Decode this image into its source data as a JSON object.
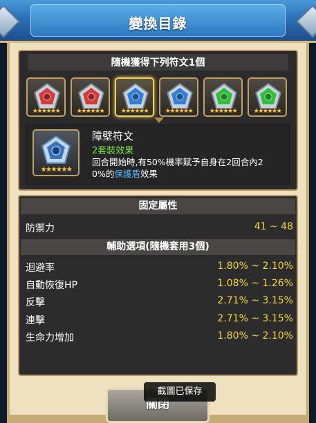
{
  "dialog": {
    "title": "變換目錄",
    "random_header": "隨機獲得下列符文1個",
    "runes": [
      {
        "name": "red-rune",
        "color": "#d83a3a",
        "stars": "★★★★★★"
      },
      {
        "name": "red-rune",
        "color": "#d83a3a",
        "stars": "★★★★★★"
      },
      {
        "name": "blue-rune",
        "color": "#2d7fd8",
        "stars": "★★★★★★"
      },
      {
        "name": "blue-rune",
        "color": "#2d7fd8",
        "stars": "★★★★★★"
      },
      {
        "name": "green-rune",
        "color": "#2fbf3a",
        "stars": "★★★★★★"
      },
      {
        "name": "green-rune",
        "color": "#2fbf3a",
        "stars": "★★★★★★"
      }
    ],
    "selected_index": 2
  },
  "detail": {
    "rune_name": "障壁符文",
    "set_effect": "2套裝效果",
    "desc_part1": "回合開始時,有50%機率賦予自身在2回合內2",
    "desc_part2": "0%的",
    "desc_highlight": "保護盾",
    "desc_part3": "效果",
    "stars": "★★★★★★"
  },
  "fixed": {
    "header": "固定屬性",
    "label": "防禦力",
    "value": "41 ~ 48"
  },
  "aux": {
    "header": "輔助選項(隨機套用3個)",
    "rows": [
      {
        "label": "迴避率",
        "value": "1.80% ~ 2.10%"
      },
      {
        "label": "自動恢復HP",
        "value": "1.08% ~ 1.26%"
      },
      {
        "label": "反擊",
        "value": "2.71% ~ 3.15%"
      },
      {
        "label": "連擊",
        "value": "2.71% ~ 3.15%"
      },
      {
        "label": "生命力增加",
        "value": "1.80% ~ 2.10%"
      }
    ]
  },
  "close_label": "關閉",
  "toast": "截圖已保存",
  "colors": {
    "accent_gold": "#f6d640",
    "green": "#7be14a",
    "blue_link": "#5bb6ff"
  }
}
